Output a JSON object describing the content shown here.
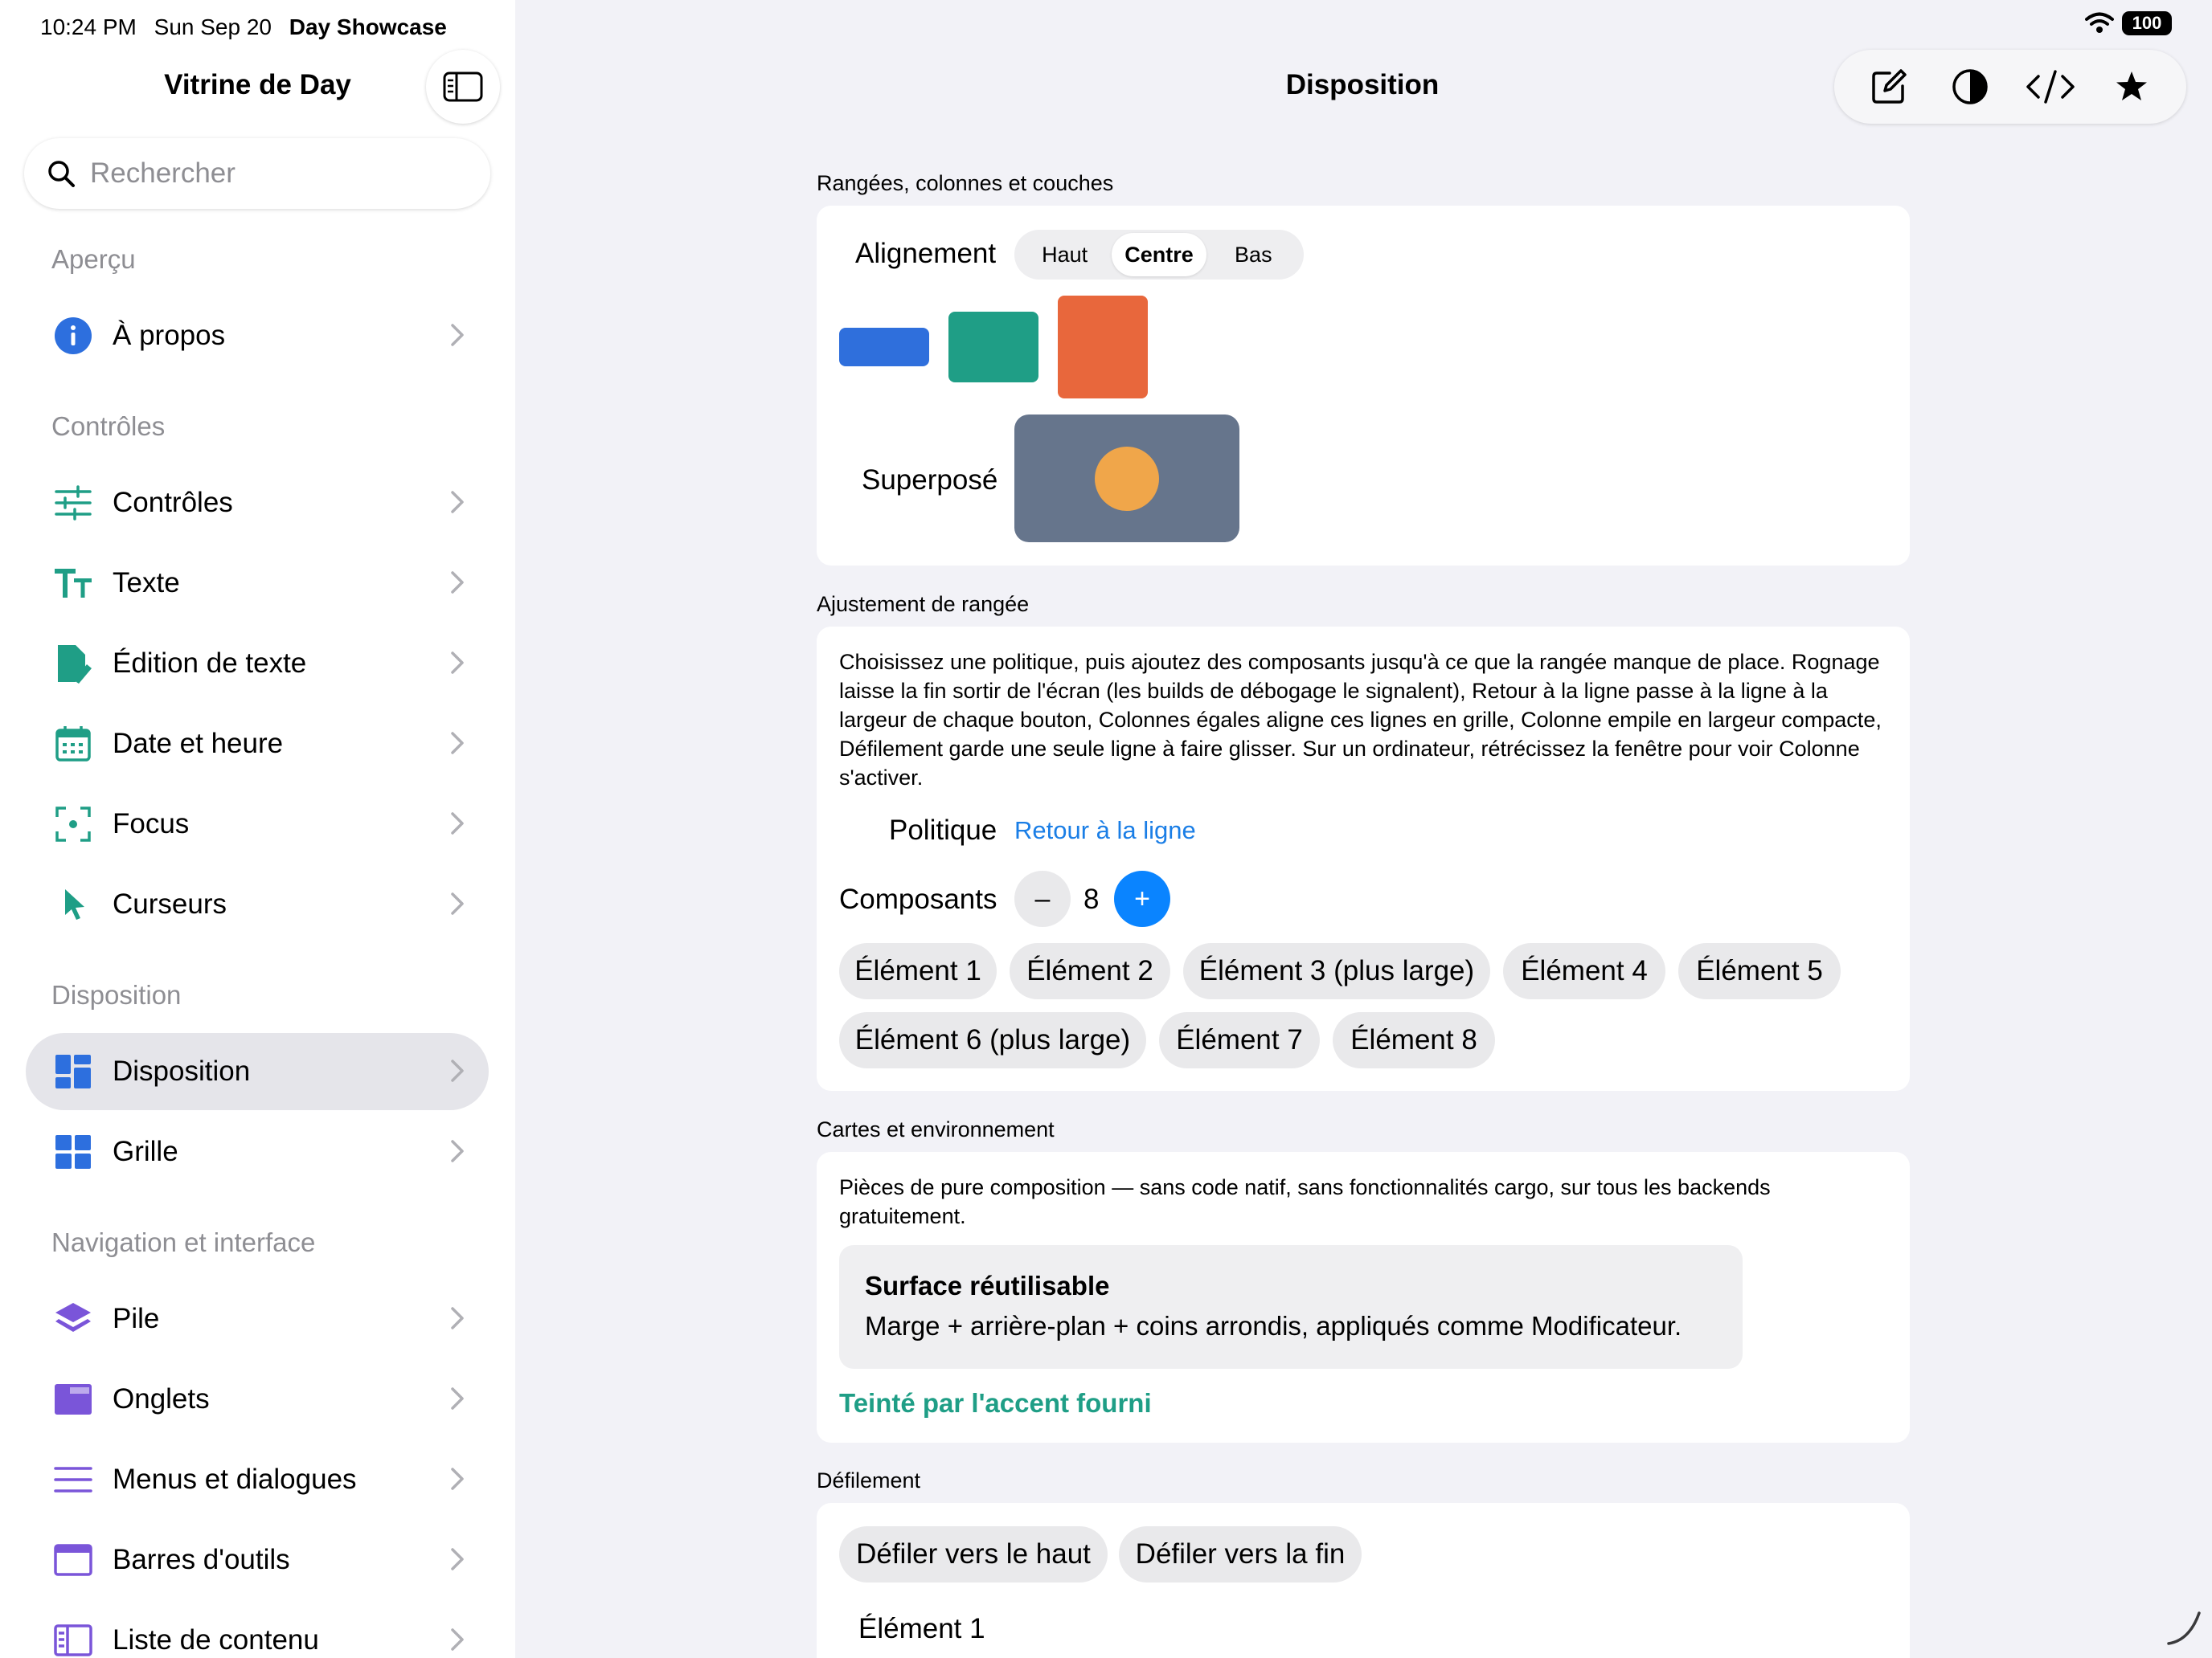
{
  "status": {
    "time": "10:24 PM",
    "date": "Sun Sep 20",
    "app_name": "Day Showcase",
    "battery": "100"
  },
  "sidebar": {
    "title": "Vitrine de Day",
    "search_placeholder": "Rechercher",
    "sections": {
      "apercu": "Aperçu",
      "controles": "Contrôles",
      "disposition": "Disposition",
      "navigation": "Navigation et interface"
    },
    "items": [
      {
        "label": "À propos",
        "icon": "info-icon"
      },
      {
        "label": "Contrôles",
        "icon": "sliders-icon"
      },
      {
        "label": "Texte",
        "icon": "text-size-icon"
      },
      {
        "label": "Édition de texte",
        "icon": "document-edit-icon"
      },
      {
        "label": "Date et heure",
        "icon": "calendar-icon"
      },
      {
        "label": "Focus",
        "icon": "focus-icon"
      },
      {
        "label": "Curseurs",
        "icon": "cursor-icon"
      },
      {
        "label": "Disposition",
        "icon": "layout-icon",
        "selected": true
      },
      {
        "label": "Grille",
        "icon": "grid-icon"
      },
      {
        "label": "Pile",
        "icon": "stack-icon"
      },
      {
        "label": "Onglets",
        "icon": "tabs-icon"
      },
      {
        "label": "Menus et dialogues",
        "icon": "menu-lines-icon"
      },
      {
        "label": "Barres d'outils",
        "icon": "toolbar-window-icon"
      },
      {
        "label": "Liste de contenu",
        "icon": "list-detail-icon"
      }
    ]
  },
  "main": {
    "title": "Disposition",
    "toolbar_icons": [
      "compose-icon",
      "contrast-icon",
      "code-icon",
      "star-icon"
    ],
    "rows": {
      "header": "Rangées, colonnes et couches",
      "alignment_label": "Alignement",
      "alignment_options": [
        "Haut",
        "Centre",
        "Bas"
      ],
      "alignment_selected": "Centre",
      "stacked_label": "Superposé",
      "colors": {
        "blue": "#2f6fdc",
        "teal": "#1f9e86",
        "orange": "#e8673c",
        "slate": "#66758c",
        "amber": "#f0a64a"
      }
    },
    "wrap": {
      "header": "Ajustement de rangée",
      "description": "Choisissez une politique, puis ajoutez des composants jusqu'à ce que la rangée manque de place. Rognage laisse la fin sortir de l'écran (les builds de débogage le signalent), Retour à la ligne passe à la ligne à la largeur de chaque bouton, Colonnes égales aligne ces lignes en grille, Colonne empile en largeur compacte, Défilement garde une seule ligne à faire glisser. Sur un ordinateur, rétrécissez la fenêtre pour voir Colonne s'activer.",
      "policy_label": "Politique",
      "policy_value": "Retour à la ligne",
      "components_label": "Composants",
      "count": "8",
      "minus": "–",
      "plus": "+",
      "chips": [
        "Élément 1",
        "Élément 2",
        "Élément 3 (plus large)",
        "Élément 4",
        "Élément 5",
        "Élément 6 (plus large)",
        "Élément 7",
        "Élément 8"
      ]
    },
    "cards": {
      "header": "Cartes et environnement",
      "description": "Pièces de pure composition — sans code natif, sans fonctionnalités cargo, sur tous les backends gratuitement.",
      "surface_title": "Surface réutilisable",
      "surface_body": "Marge + arrière-plan + coins arrondis, appliqués comme Modificateur.",
      "tinted": "Teinté par l'accent fourni",
      "accent_color": "#1f9e86"
    },
    "scroll": {
      "header": "Défilement",
      "to_top": "Défiler vers le haut",
      "to_end": "Défiler vers la fin",
      "first_item": "Élément 1"
    }
  }
}
